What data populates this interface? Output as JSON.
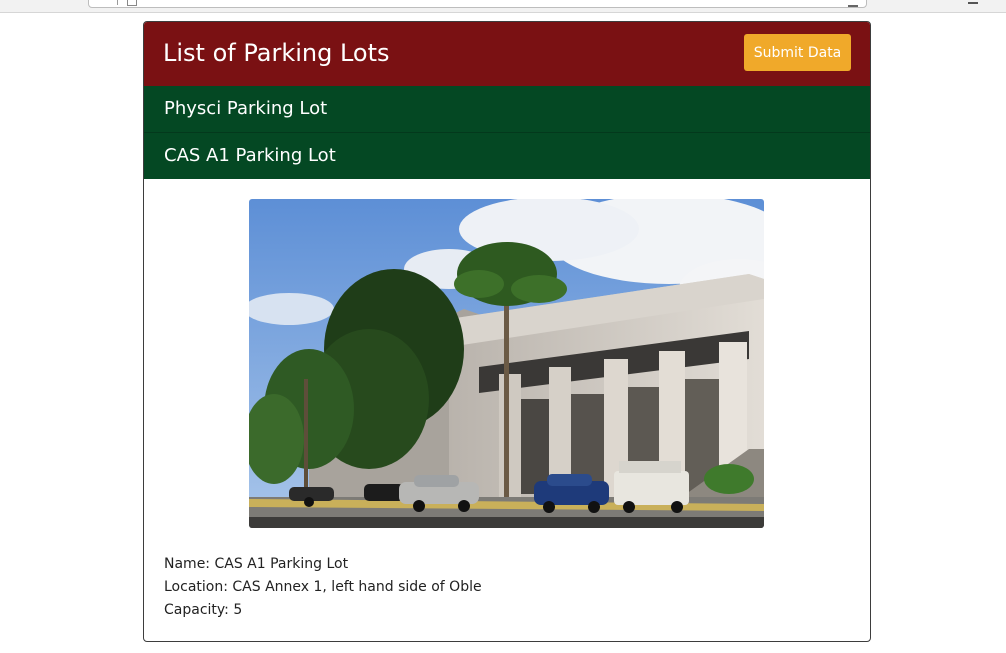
{
  "header": {
    "title": "List of Parking Lots",
    "submit_label": "Submit Data"
  },
  "lots": [
    {
      "label": "Physci Parking Lot"
    },
    {
      "label": "CAS A1 Parking Lot"
    }
  ],
  "selected_lot": {
    "name_line": "Name: CAS A1 Parking Lot",
    "location_line": "Location: CAS Annex 1, left hand side of Oble",
    "capacity_line": "Capacity: 5"
  },
  "colors": {
    "header_bg": "#7a1113",
    "submit_bg": "#f0a92a",
    "lot_item_bg": "#044823"
  },
  "icons": {
    "address_page": "page-icon",
    "address_end": "bookmark-icon",
    "browser_menu": "menu-icon"
  }
}
